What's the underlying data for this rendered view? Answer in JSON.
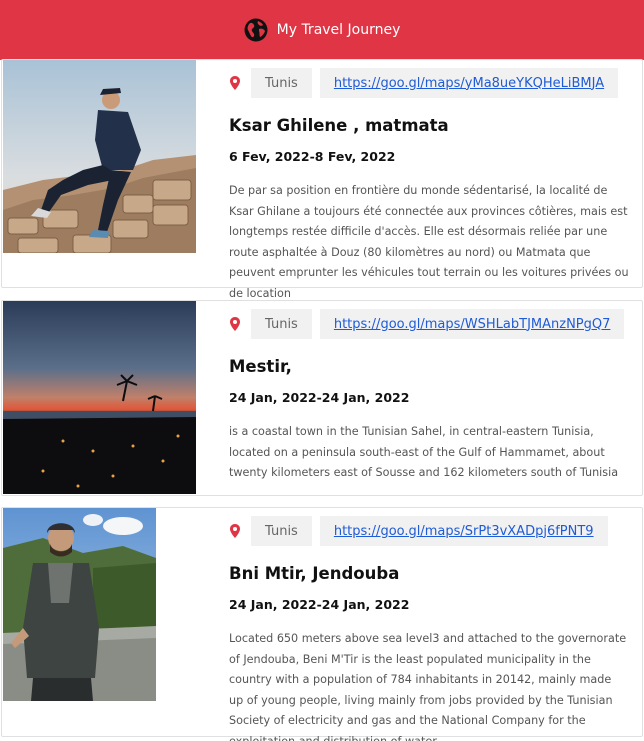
{
  "header": {
    "title": "My Travel Journey",
    "icon": "globe-icon",
    "background": "#df3545"
  },
  "entries": [
    {
      "location": "Tunis",
      "map_link": "https://goo.gl/maps/yMa8ueYKQHeLiBMJA",
      "title": "Ksar Ghilene , matmata",
      "dates": "6 Fev, 2022-8 Fev, 2022",
      "description": "De par sa position en frontière du monde sédentarisé, la localité de Ksar Ghilane a toujours été connectée aux provinces côtières, mais est longtemps restée difficile d'accès. Elle est désormais reliée par une route asphaltée à Douz (80 kilomètres au nord) ou Matmata que peuvent emprunter les véhicules tout terrain ou les voitures privées ou de location"
    },
    {
      "location": "Tunis",
      "map_link": "https://goo.gl/maps/WSHLabTJMAnzNPgQ7",
      "title": "Mestir,",
      "dates": "24 Jan, 2022-24 Jan, 2022",
      "description": "is a coastal town in the Tunisian Sahel, in central-eastern Tunisia, located on a peninsula south-east of the Gulf of Hammamet, about twenty kilometers east of Sousse and 162 kilometers south of Tunisia"
    },
    {
      "location": "Tunis",
      "map_link": "https://goo.gl/maps/SrPt3vXADpj6fPNT9",
      "title": "Bni Mtir, Jendouba",
      "dates": "24 Jan, 2022-24 Jan, 2022",
      "description": "Located 650 meters above sea level3 and attached to the governorate of Jendouba, Beni M'Tir is the least populated municipality in the country with a population of 784 inhabitants in 20142, mainly made up of young people, living mainly from jobs provided by the Tunisian Society of electricity and gas and the National Company for the exploitation and distribution of water"
    }
  ]
}
